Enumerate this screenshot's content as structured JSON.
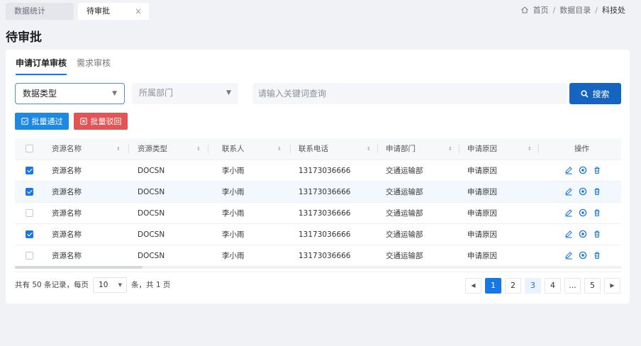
{
  "tabs": [
    {
      "label": "数据统计"
    },
    {
      "label": "待审批",
      "close": "×"
    }
  ],
  "breadcrumb": {
    "home": "首页",
    "sep": "/",
    "catalog": "数据目录",
    "current": "科技处"
  },
  "page_title": "待审批",
  "subtabs": [
    {
      "label": "申请订单审核"
    },
    {
      "label": "需求审核"
    }
  ],
  "filters": {
    "type_value": "数据类型",
    "dept_placeholder": "所属部门",
    "keyword_placeholder": "请输入关键词查询",
    "search_label": "搜索"
  },
  "batch": {
    "pass_label": "批量通过",
    "reject_label": "批量驳回"
  },
  "table": {
    "columns": [
      "资源名称",
      "资源类型",
      "联系人",
      "联系电话",
      "申请部门",
      "申请原因",
      "操作"
    ],
    "rows": [
      {
        "checked": true,
        "name": "资源名称",
        "type": "DOCSN",
        "contact": "李小雨",
        "phone": "13173036666",
        "dept": "交通运输部",
        "reason": "申请原因"
      },
      {
        "checked": true,
        "name": "资源名称",
        "type": "DOCSN",
        "contact": "李小雨",
        "phone": "13173036666",
        "dept": "交通运输部",
        "reason": "申请原因"
      },
      {
        "checked": false,
        "name": "资源名称",
        "type": "DOCSN",
        "contact": "李小雨",
        "phone": "13173036666",
        "dept": "交通运输部",
        "reason": "申请原因"
      },
      {
        "checked": true,
        "name": "资源名称",
        "type": "DOCSN",
        "contact": "李小雨",
        "phone": "13173036666",
        "dept": "交通运输部",
        "reason": "申请原因"
      },
      {
        "checked": false,
        "name": "资源名称",
        "type": "DOCSN",
        "contact": "李小雨",
        "phone": "13173036666",
        "dept": "交通运输部",
        "reason": "申请原因"
      }
    ]
  },
  "footer": {
    "total_prefix": "共有 50 条记录，每页",
    "page_size": "10",
    "total_suffix": "条，共 1 页",
    "pages": [
      "1",
      "2",
      "3",
      "4",
      "...",
      "5"
    ],
    "current_page": "1"
  },
  "colors": {
    "primary": "#1677e5",
    "danger": "#e25555",
    "search": "#1565c0"
  }
}
